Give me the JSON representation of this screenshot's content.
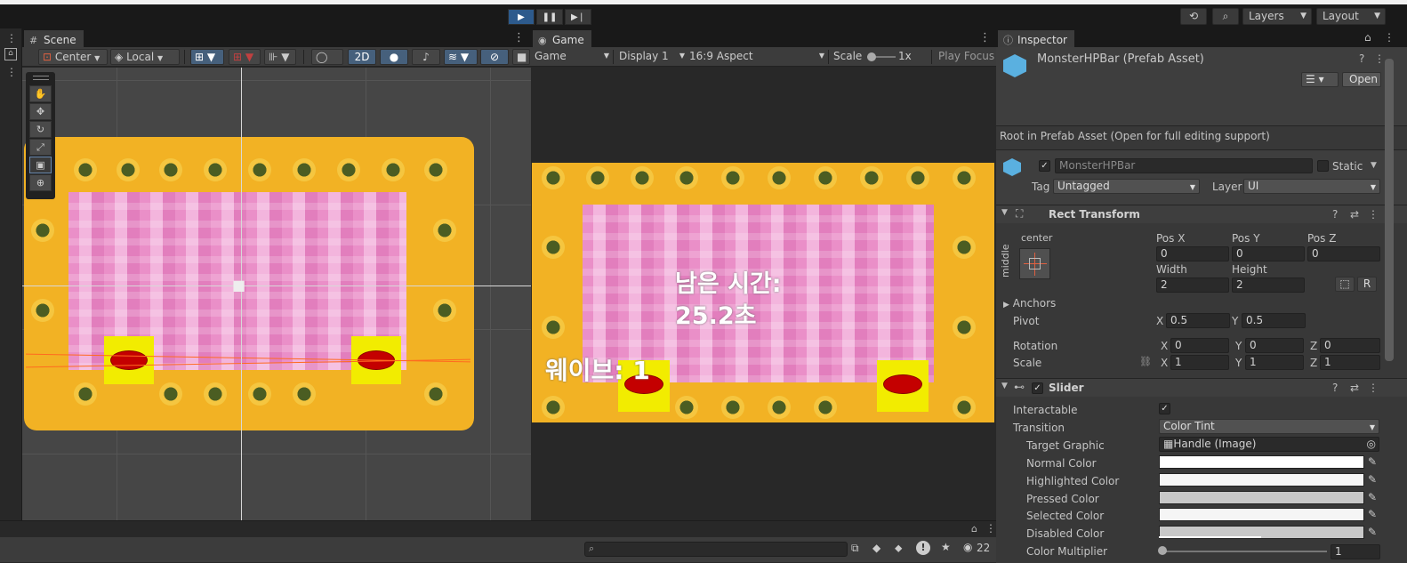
{
  "toolbar": {
    "play_icon": "play-icon",
    "pause_icon": "pause-icon",
    "step_icon": "step-icon",
    "layers_label": "Layers",
    "layout_label": "Layout"
  },
  "scene": {
    "tab_label": "Scene",
    "pivot_mode": "Center",
    "space_mode": "Local",
    "mode_2d": "2D"
  },
  "game": {
    "tab_label": "Game",
    "view_mode": "Game",
    "display": "Display 1",
    "aspect": "16:9 Aspect",
    "scale_label": "Scale",
    "scale_value": "1x",
    "play_focus": "Play Focus",
    "hud_time_line1": "남은 시간:",
    "hud_time_line2": "25.2초",
    "hud_wave": "웨이브: 1"
  },
  "inspector": {
    "tab_label": "Inspector",
    "asset_title": "MonsterHPBar (Prefab Asset)",
    "open_label": "Open",
    "prefab_note": "Root in Prefab Asset (Open for full editing support)",
    "object_name": "MonsterHPBar",
    "static_label": "Static",
    "tag_label": "Tag",
    "tag_value": "Untagged",
    "layer_label": "Layer",
    "layer_value": "UI",
    "rect_transform": {
      "title": "Rect Transform",
      "anchor_h": "center",
      "anchor_v": "middle",
      "pos_x_label": "Pos X",
      "pos_y_label": "Pos Y",
      "pos_z_label": "Pos Z",
      "pos_x": "0",
      "pos_y": "0",
      "pos_z": "0",
      "width_label": "Width",
      "height_label": "Height",
      "width": "2",
      "height": "2",
      "r_label": "R",
      "anchors_label": "Anchors",
      "pivot_label": "Pivot",
      "pivot_x_label": "X",
      "pivot_x": "0.5",
      "pivot_y_label": "Y",
      "pivot_y": "0.5",
      "rotation_label": "Rotation",
      "rot_x": "0",
      "rot_y": "0",
      "rot_z": "0",
      "scale_label": "Scale",
      "scale_x": "1",
      "scale_y": "1",
      "scale_z": "1",
      "x_label": "X",
      "y_label": "Y",
      "z_label": "Z"
    },
    "slider": {
      "title": "Slider",
      "interactable_label": "Interactable",
      "transition_label": "Transition",
      "transition_value": "Color Tint",
      "target_graphic_label": "Target Graphic",
      "target_graphic_value": "Handle (Image)",
      "normal_color_label": "Normal Color",
      "highlighted_color_label": "Highlighted Color",
      "pressed_color_label": "Pressed Color",
      "selected_color_label": "Selected Color",
      "disabled_color_label": "Disabled Color",
      "color_multiplier_label": "Color Multiplier",
      "color_multiplier_value": "1",
      "colors": {
        "normal": "#ffffff",
        "highlighted": "#f5f5f5",
        "pressed": "#c8c8c8",
        "selected": "#f5f5f5",
        "disabled": "#c8c8c8"
      }
    }
  },
  "bottom": {
    "count": "22"
  },
  "colors": {
    "accent_blue": "#2d5a8c",
    "panel_bg": "#282828",
    "inspector_bg": "#383838"
  }
}
